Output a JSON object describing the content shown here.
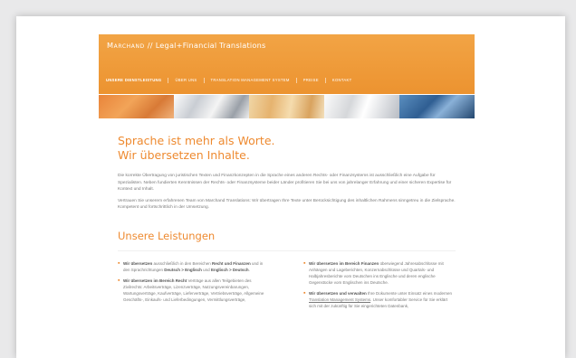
{
  "header": {
    "brand": "Marchand",
    "separator": "//",
    "tagline": "Legal+Financial Translations"
  },
  "nav": {
    "items": [
      "Unsere Dienstleistung",
      "Über uns",
      "Translation Management System",
      "Preise",
      "Kontakt"
    ]
  },
  "headline": {
    "line1": "Sprache ist mehr als Worte.",
    "line2": "Wir übersetzen Inhalte."
  },
  "intro": {
    "p1": "Die korrekte Übertragung von juristischen Texten und Finanzkonzepten in die Sprache eines anderen Rechts- oder Finanzsystems ist ausschließlich eine Aufgabe für Spezialisten. Neben fundierten Kenntnissen der Rechts- oder Finanzsysteme beider Länder profitieren Sie bei uns von jahrelanger Erfahrung und einer sicheren Expertise für Kontext und Inhalt.",
    "p2": "Vertrauen Sie unserem erfahrenen Team von Marchand Translations: Wir übertragen Ihre Texte unter Berücksichtigung des inhaltlichen Rahmens sinngetreu in die Zielsprache. Kompetent und fortschrittlich in der Umsetzung."
  },
  "services": {
    "title": "Unsere Leistungen",
    "left": [
      {
        "lead": "Wir übersetzen",
        "text1": " ausschließlich in den Bereichen ",
        "b1": "Recht und Finanzen",
        "text2": " und in den Sprachrichtungen ",
        "b2": "Deutsch > Englisch",
        "text3": " und ",
        "b3": "Englisch > Deutsch",
        "text4": "."
      },
      {
        "lead": "Wir übersetzen im Bereich Recht",
        "text1": " Verträge aus allen Teilgebieten des Zivilrechts: Arbeitsverträge, Lizenzverträge, Nutzungsvereinbarungen, Wartungsverträge, Kaufverträge, Lieferverträge, Vertriebsverträge, Allgemeine Geschäfts-, Einkaufs- und Lieferbedingungen, Vermittlungsverträge,"
      }
    ],
    "right": [
      {
        "lead": "Wir übersetzen im Bereich Finanzen",
        "text1": " überwiegend Jahresabschlüsse mit Anhängen und Lageberichten, Konzernabschlüsse und Quartals- und Halbjahresberichte vom Deutschen ins Englische und deren englische Gegenstücke vom Englischen ins Deutsche."
      },
      {
        "lead": "Wir übersetzen und verwalten",
        "text1": " Ihre Dokumente unter Einsatz eines modernen ",
        "link": "Translation Management Systems",
        "text2": ". Unser komfortabler Service für Sie erklärt sich mit der zukünftig für Sie eingerichteten Datenbank,"
      }
    ]
  },
  "colors": {
    "accent": "#ee8a30",
    "header_bg": "#ef9a35",
    "page_bg": "#e9e9ea"
  }
}
